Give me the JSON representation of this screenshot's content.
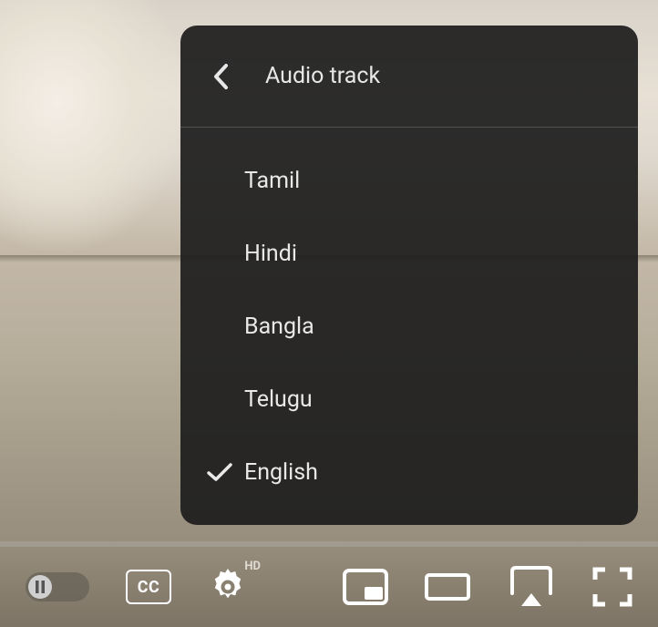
{
  "menu": {
    "title": "Audio track",
    "items": [
      {
        "label": "Tamil",
        "selected": false
      },
      {
        "label": "Hindi",
        "selected": false
      },
      {
        "label": "Bangla",
        "selected": false
      },
      {
        "label": "Telugu",
        "selected": false
      },
      {
        "label": "English",
        "selected": true
      }
    ]
  },
  "controls": {
    "cc_label": "CC",
    "hd_label": "HD"
  }
}
